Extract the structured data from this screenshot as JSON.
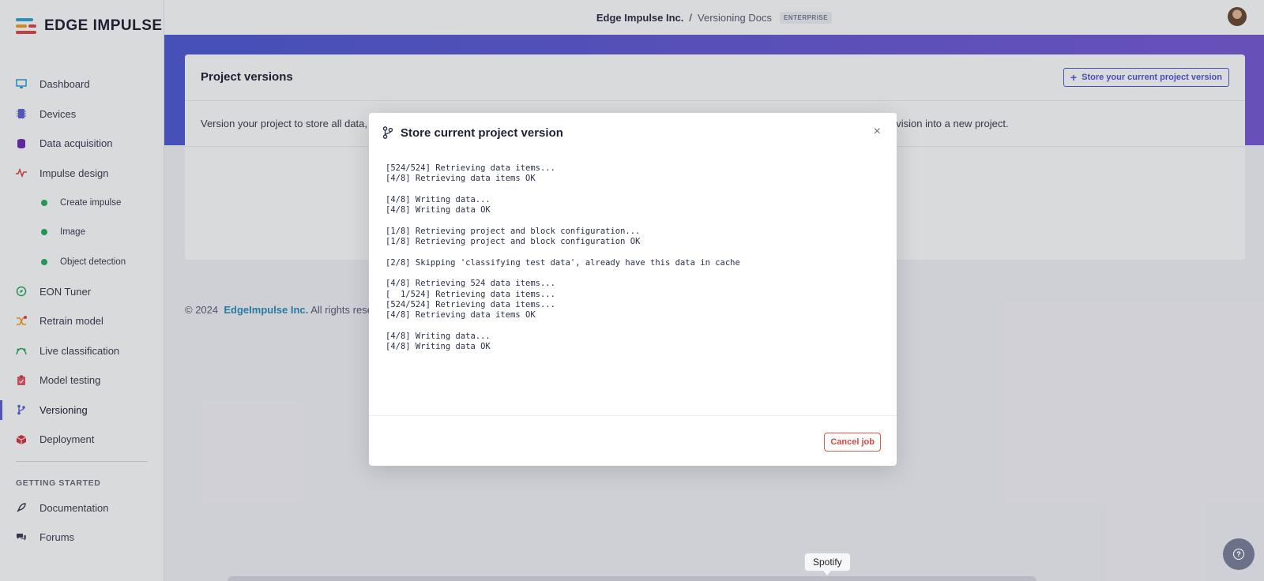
{
  "app": {
    "brand": "EDGE IMPULSE"
  },
  "header": {
    "org": "Edge Impulse Inc.",
    "separator": "/",
    "project": "Versioning Docs",
    "badge": "ENTERPRISE"
  },
  "sidebar": {
    "items": [
      {
        "label": "Dashboard",
        "icon": "monitor-icon",
        "color": "#2a9fd6"
      },
      {
        "label": "Devices",
        "icon": "chip-icon",
        "color": "#5b63d3"
      },
      {
        "label": "Data acquisition",
        "icon": "database-icon",
        "color": "#6a2fb0"
      },
      {
        "label": "Impulse design",
        "icon": "pulse-icon",
        "color": "#e04848"
      },
      {
        "label": "Create impulse",
        "icon": "status-dot",
        "color": "#27ae60"
      },
      {
        "label": "Image",
        "icon": "status-dot",
        "color": "#27ae60"
      },
      {
        "label": "Object detection",
        "icon": "status-dot",
        "color": "#27ae60"
      },
      {
        "label": "EON Tuner",
        "icon": "compass-icon",
        "color": "#27ae60"
      },
      {
        "label": "Retrain model",
        "icon": "shuffle-icon",
        "color": "#f0a020"
      },
      {
        "label": "Live classification",
        "icon": "curve-icon",
        "color": "#27ae60"
      },
      {
        "label": "Model testing",
        "icon": "clipboard-icon",
        "color": "#e05a6a"
      },
      {
        "label": "Versioning",
        "icon": "branch-icon",
        "color": "#5b63d3"
      },
      {
        "label": "Deployment",
        "icon": "cube-icon",
        "color": "#d9363e"
      }
    ],
    "section_label": "GETTING STARTED",
    "section_items": [
      {
        "label": "Documentation",
        "icon": "rocket-icon",
        "color": "#3b3f54"
      },
      {
        "label": "Forums",
        "icon": "chat-icon",
        "color": "#3b3f54"
      }
    ]
  },
  "card": {
    "title": "Project versions",
    "store_button": "Store your current project version",
    "description_left": "Version your project to store all data, co",
    "description_right": "evision into a new project."
  },
  "footer": {
    "copyright": "© 2024",
    "company_link": "EdgeImpulse Inc.",
    "rights": "All rights reserve"
  },
  "modal": {
    "title": "Store current project version",
    "log": "[524/524] Retrieving data items...\n[4/8] Retrieving data items OK\n\n[4/8] Writing data...\n[4/8] Writing data OK\n\n[1/8] Retrieving project and block configuration...\n[1/8] Retrieving project and block configuration OK\n\n[2/8] Skipping 'classifying test data', already have this data in cache\n\n[4/8] Retrieving 524 data items...\n[  1/524] Retrieving data items...\n[524/524] Retrieving data items...\n[4/8] Retrieving data items OK\n\n[4/8] Writing data...\n[4/8] Writing data OK",
    "cancel_button": "Cancel job",
    "close": "×"
  },
  "tooltip": {
    "label": "Spotify"
  },
  "help_button": {
    "glyph": "?"
  }
}
